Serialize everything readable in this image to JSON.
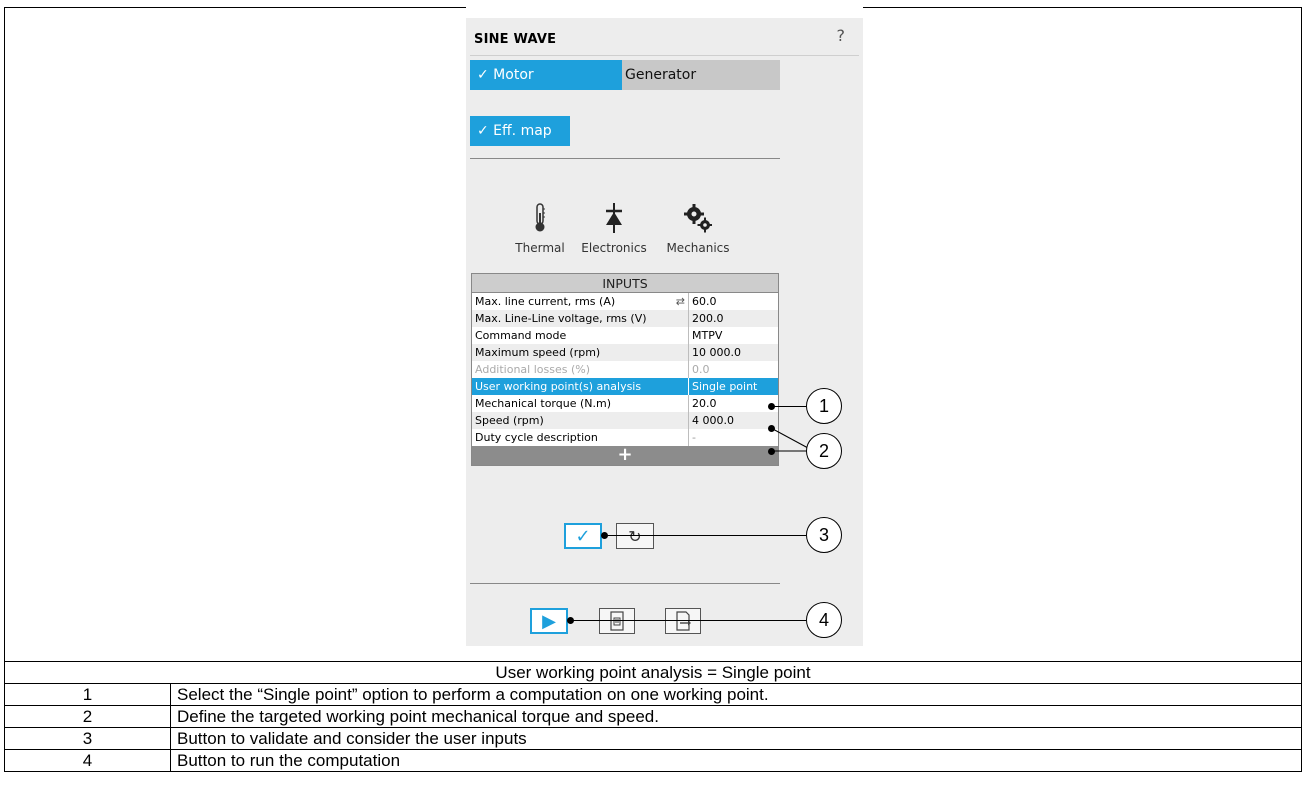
{
  "panel": {
    "title": "SINE WAVE",
    "help": "?",
    "tabs": [
      {
        "label": "✓ Motor",
        "active": true
      },
      {
        "label": "Generator",
        "active": false
      }
    ],
    "eff_map_label": "✓ Eff. map",
    "tools": [
      {
        "label": "Thermal",
        "icon": "thermometer-icon"
      },
      {
        "label": "Electronics",
        "icon": "diode-icon"
      },
      {
        "label": "Mechanics",
        "icon": "gears-icon"
      }
    ],
    "inputs": {
      "header": "INPUTS",
      "rows": [
        {
          "label": "Max. line current, rms (A)",
          "value": "60.0"
        },
        {
          "label": "Max. Line-Line voltage, rms (V)",
          "value": "200.0"
        },
        {
          "label": "Command mode",
          "value": "MTPV"
        },
        {
          "label": "Maximum speed (rpm)",
          "value": "10 000.0"
        },
        {
          "label": "Additional losses (%)",
          "value": "0.0"
        },
        {
          "label": "User working point(s) analysis",
          "value": "Single point"
        },
        {
          "label": "Mechanical torque (N.m)",
          "value": "20.0"
        },
        {
          "label": "Speed (rpm)",
          "value": "4 000.0"
        },
        {
          "label": "Duty cycle description",
          "value": "-"
        }
      ],
      "add": "+"
    }
  },
  "callouts": [
    "1",
    "2",
    "3",
    "4"
  ],
  "caption": {
    "title": "User working point analysis = Single point",
    "items": [
      {
        "num": "1",
        "text": "Select the “Single point” option to perform a computation on one working point."
      },
      {
        "num": "2",
        "text": "Define the targeted working point mechanical torque and speed."
      },
      {
        "num": "3",
        "text": "Button to validate and consider the user inputs"
      },
      {
        "num": "4",
        "text": "Button to run the computation"
      }
    ]
  },
  "colors": {
    "accent": "#1ea0dc",
    "panel_bg": "#ededed"
  }
}
